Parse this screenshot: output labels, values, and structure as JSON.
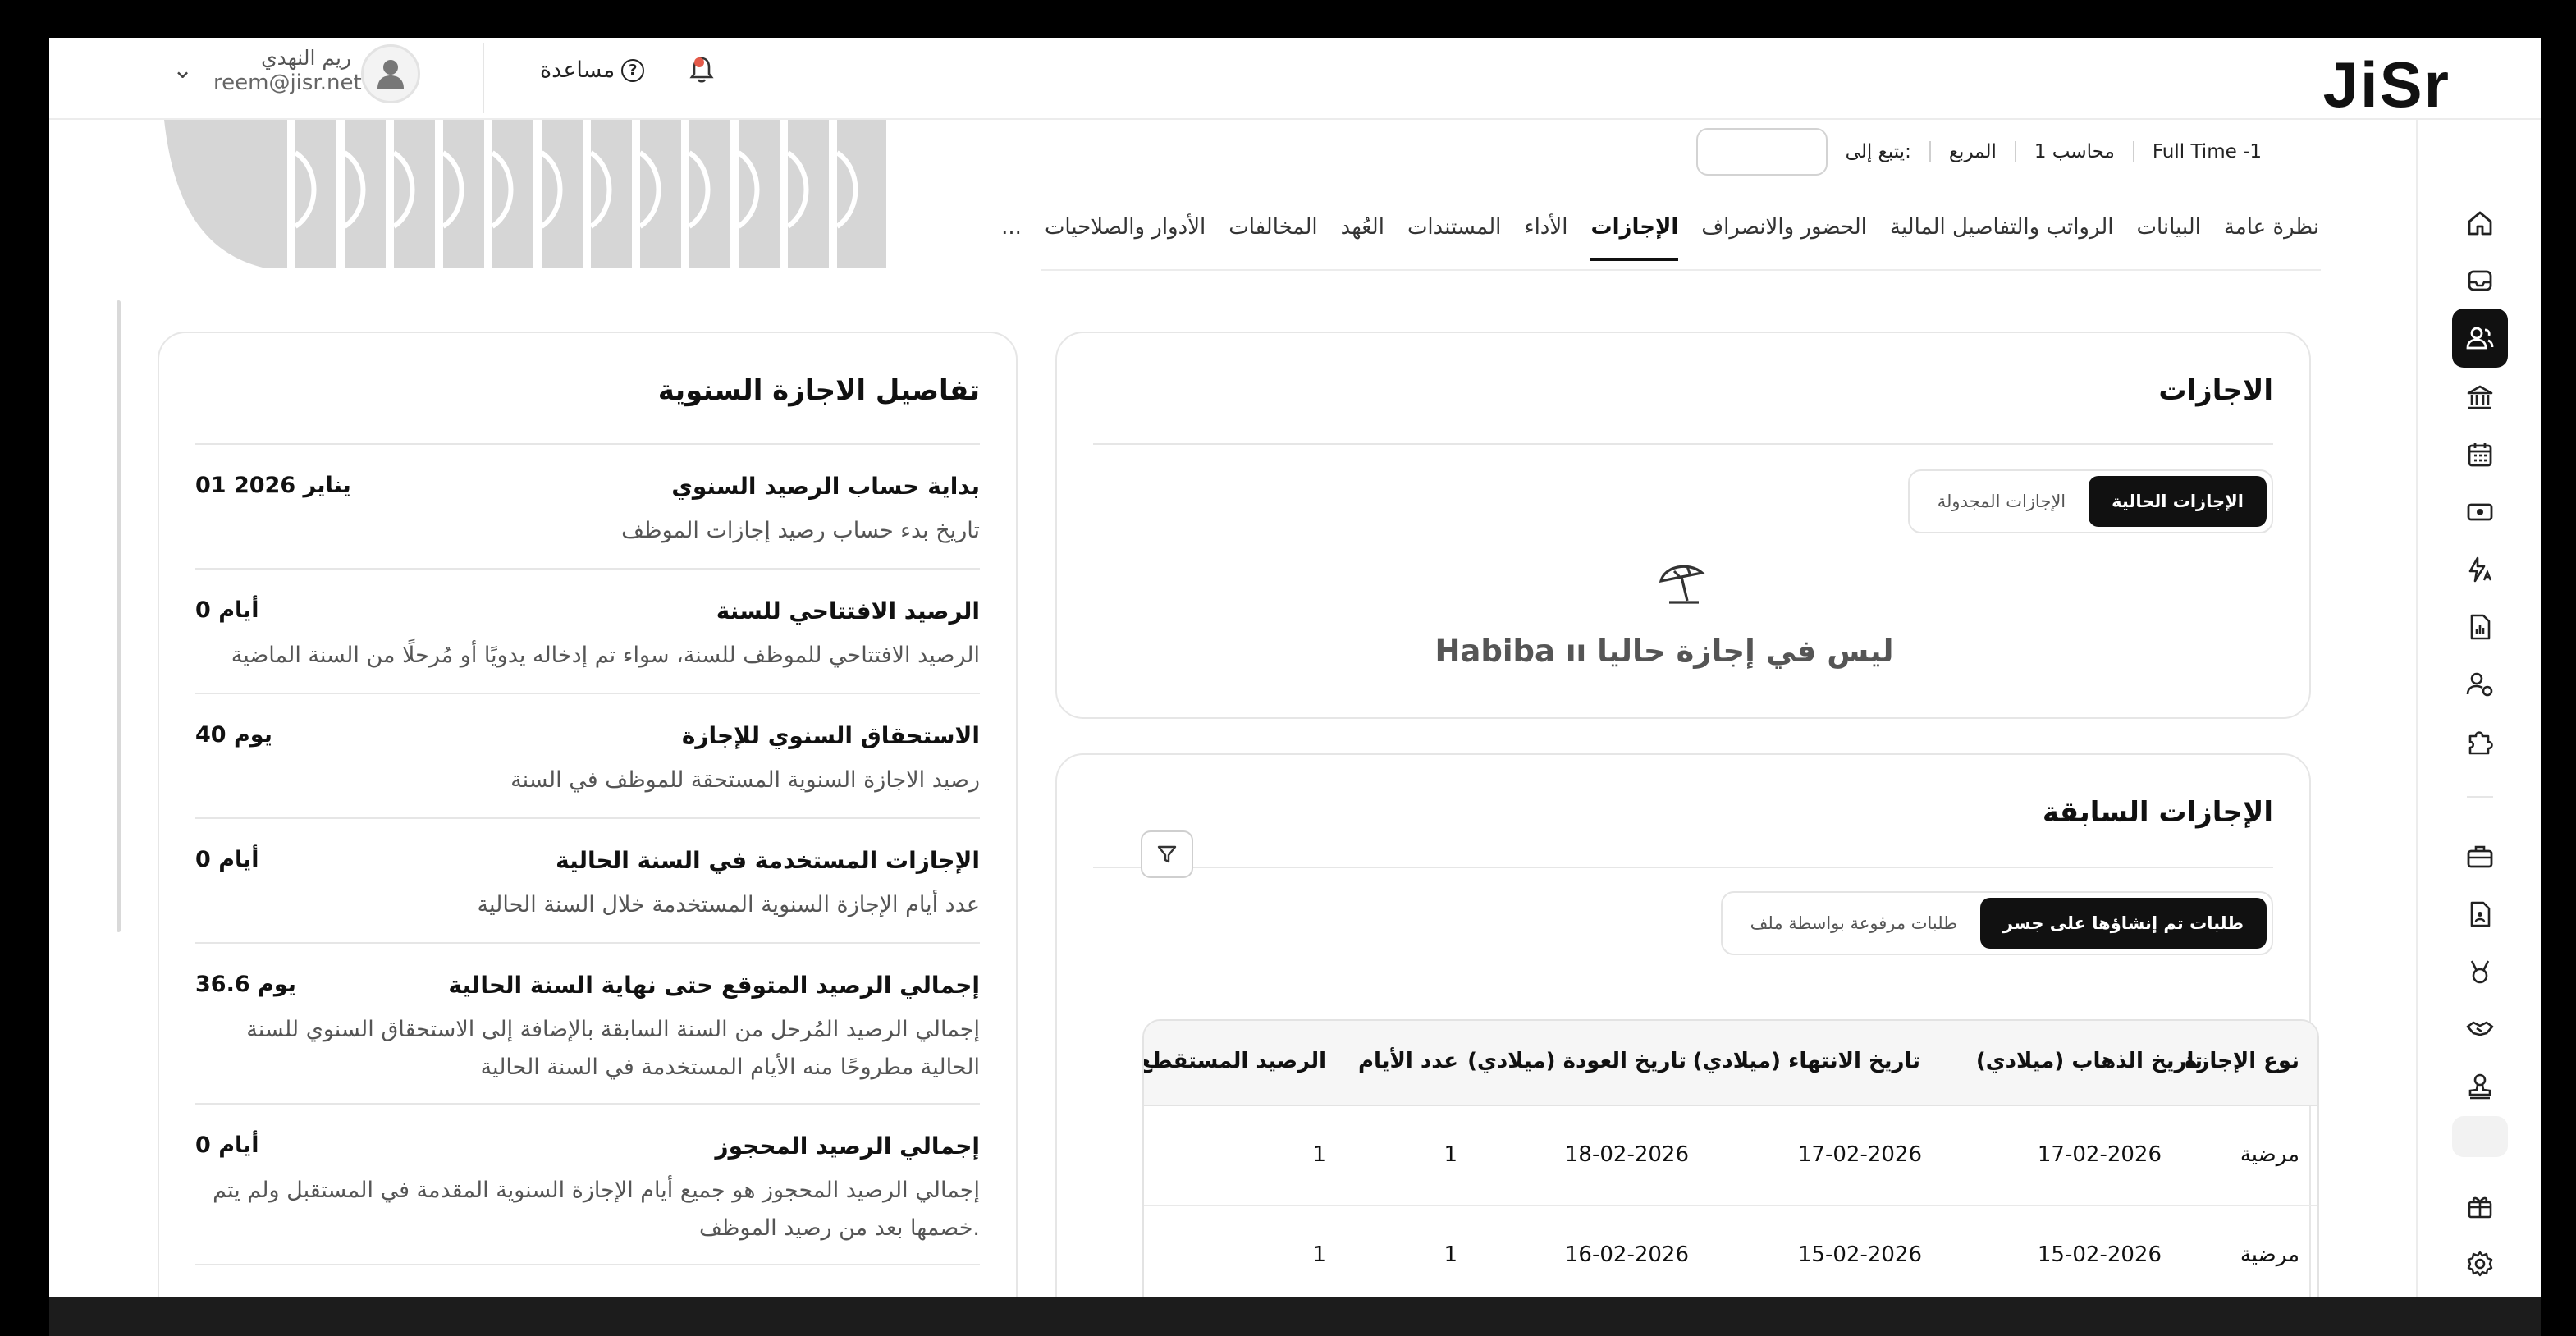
{
  "app": {
    "logo": "JiSr"
  },
  "header": {
    "user_name": "ريم النهدي",
    "user_email": "reem@jisr.net",
    "help_label": "مساعدة",
    "help_icon": "?"
  },
  "employee_meta": {
    "items": [
      "Full Time -1",
      "محاسب 1",
      "المربع"
    ],
    "follows_label": "يتبع إلى:",
    "follows_value": ""
  },
  "tabs": [
    {
      "label": "نظرة عامة",
      "active": false
    },
    {
      "label": "البيانات",
      "active": false
    },
    {
      "label": "الرواتب والتفاصيل المالية",
      "active": false
    },
    {
      "label": "الحضور والانصراف",
      "active": false
    },
    {
      "label": "الإجازات",
      "active": true
    },
    {
      "label": "الأداء",
      "active": false
    },
    {
      "label": "المستندات",
      "active": false
    },
    {
      "label": "العُهد",
      "active": false
    },
    {
      "label": "المخالفات",
      "active": false
    },
    {
      "label": "الأدوار والصلاحيات",
      "active": false
    },
    {
      "label": "...",
      "active": false
    }
  ],
  "current_leaves": {
    "title": "الاجازات",
    "segment": [
      "الإجازات الحالية",
      "الإجازات المجدولة"
    ],
    "empty_icon": "beach-umbrella",
    "empty_text": "Habiba ıı ليس في إجازة حاليا"
  },
  "past_leaves": {
    "title": "الإجازات السابقة",
    "segment": [
      "طلبات تم إنشاؤها على جسر",
      "طلبات مرفوعة بواسطة ملف"
    ],
    "columns": [
      "نوع الإجازة",
      "تاريخ الذهاب (ميلادي)",
      "تاريخ الانتهاء (ميلادي)",
      "تاريخ العودة (ميلادي)",
      "عدد الأيام",
      "الرصيد المستقطع"
    ],
    "rows": [
      [
        "مرضية",
        "17-02-2026",
        "17-02-2026",
        "18-02-2026",
        "1",
        "1"
      ],
      [
        "مرضية",
        "15-02-2026",
        "15-02-2026",
        "16-02-2026",
        "1",
        "1"
      ]
    ]
  },
  "annual_details": {
    "title": "تفاصيل الاجازة السنوية",
    "items": [
      {
        "label": "بداية حساب الرصيد السنوي",
        "value": "01 يناير 2026",
        "desc": "تاريخ بدء حساب رصيد إجازات الموظف"
      },
      {
        "label": "الرصيد الافتتاحي للسنة",
        "value": "0 أيام",
        "desc": "الرصيد الافتتاحي للموظف للسنة، سواء تم إدخاله يدويًا أو مُرحلًا من السنة الماضية"
      },
      {
        "label": "الاستحقاق السنوي للإجازة",
        "value": "40 يوم",
        "desc": "رصيد الاجازة السنوية المستحقة للموظف في السنة"
      },
      {
        "label": "الإجازات المستخدمة في السنة الحالية",
        "value": "0 أيام",
        "desc": "عدد أيام الإجازة السنوية المستخدمة خلال السنة الحالية"
      },
      {
        "label": "إجمالي الرصيد المتوقع حتى نهاية السنة الحالية",
        "value": "36.6 يوم",
        "desc": "إجمالي الرصيد المُرحل من السنة السابقة بالإضافة إلى الاستحقاق السنوي للسنة الحالية مطروحًا منه الأيام المستخدمة في السنة الحالية"
      },
      {
        "label": "إجمالي الرصيد المحجوز",
        "value": "0 أيام",
        "desc": "إجمالي الرصيد المحجوز هو جميع أيام الإجازة السنوية المقدمة في المستقبل ولم يتم خصمها بعد من رصيد الموظف."
      }
    ]
  },
  "sidebar_icons": [
    "home-icon",
    "inbox-icon",
    "employees-icon",
    "bank-icon",
    "calendar-icon",
    "money-icon",
    "flash-icon",
    "report-icon",
    "user-settings-icon",
    "puzzle-icon",
    "briefcase-icon",
    "document-icon",
    "trophy-icon",
    "handshake-icon",
    "stamp-icon",
    "gift-icon",
    "settings-icon"
  ]
}
